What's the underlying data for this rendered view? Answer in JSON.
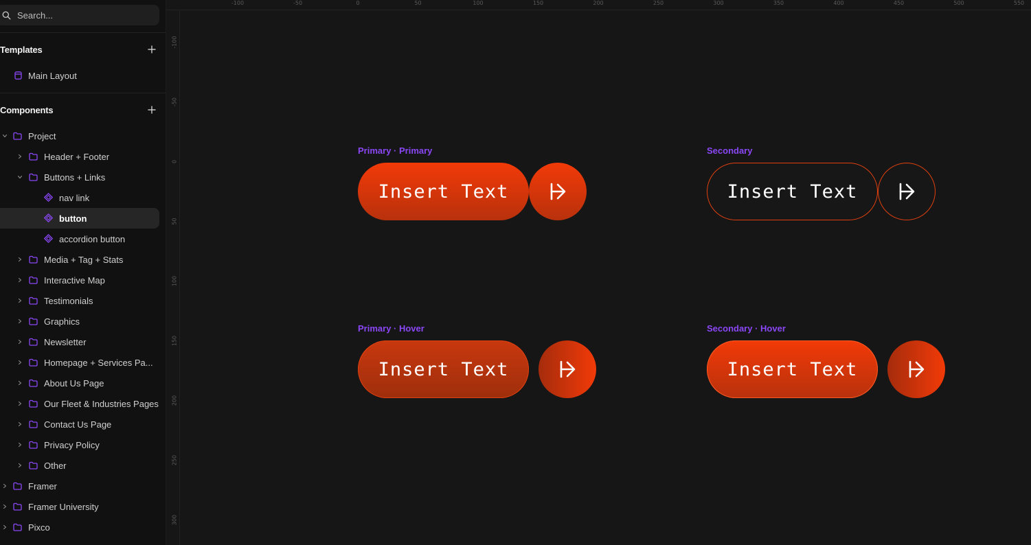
{
  "sidebar": {
    "search_placeholder": "Search...",
    "templates": {
      "title": "Templates",
      "items": [
        {
          "label": "Main Layout"
        }
      ]
    },
    "components": {
      "title": "Components",
      "tree": [
        {
          "label": "Project",
          "level": 0,
          "expanded": true
        },
        {
          "label": "Header + Footer",
          "level": 1,
          "expanded": false
        },
        {
          "label": "Buttons + Links",
          "level": 1,
          "expanded": true
        },
        {
          "label": "nav link",
          "level": 2,
          "type": "component"
        },
        {
          "label": "button",
          "level": 2,
          "type": "component",
          "selected": true
        },
        {
          "label": "accordion button",
          "level": 2,
          "type": "component"
        },
        {
          "label": "Media + Tag + Stats",
          "level": 1
        },
        {
          "label": "Interactive Map",
          "level": 1
        },
        {
          "label": "Testimonials",
          "level": 1
        },
        {
          "label": "Graphics",
          "level": 1
        },
        {
          "label": "Newsletter",
          "level": 1
        },
        {
          "label": "Homepage + Services Pa...",
          "level": 1
        },
        {
          "label": "About Us Page",
          "level": 1
        },
        {
          "label": "Our Fleet & Industries Pages",
          "level": 1
        },
        {
          "label": "Contact Us Page",
          "level": 1
        },
        {
          "label": "Privacy Policy",
          "level": 1
        },
        {
          "label": "Other",
          "level": 1
        },
        {
          "label": "Framer",
          "level": 0
        },
        {
          "label": "Framer University",
          "level": 0
        },
        {
          "label": "Pixco",
          "level": 0
        }
      ]
    }
  },
  "ruler": {
    "top": [
      "-100",
      "-50",
      "0",
      "50",
      "100",
      "150",
      "200",
      "250",
      "300",
      "350",
      "400",
      "450",
      "500",
      "550"
    ],
    "left": [
      "-100",
      "-50",
      "0",
      "50",
      "100",
      "150",
      "200",
      "250",
      "300"
    ]
  },
  "canvas": {
    "variants": [
      {
        "label": "Primary · Primary",
        "text": "Insert Text"
      },
      {
        "label": "Secondary",
        "text": "Insert Text"
      },
      {
        "label": "Primary · Hover",
        "text": "Insert Text"
      },
      {
        "label": "Secondary · Hover",
        "text": "Insert Text"
      }
    ]
  },
  "colors": {
    "accent_purple": "#8a47f5",
    "button_orange": "#f23a08",
    "background": "#161616",
    "sidebar": "#111111"
  },
  "icons": {
    "search": "search-icon",
    "add": "plus-icon",
    "folder": "folder-icon",
    "component": "component-icon",
    "template": "template-icon",
    "arrow": "arrow-right-to-line-icon"
  }
}
